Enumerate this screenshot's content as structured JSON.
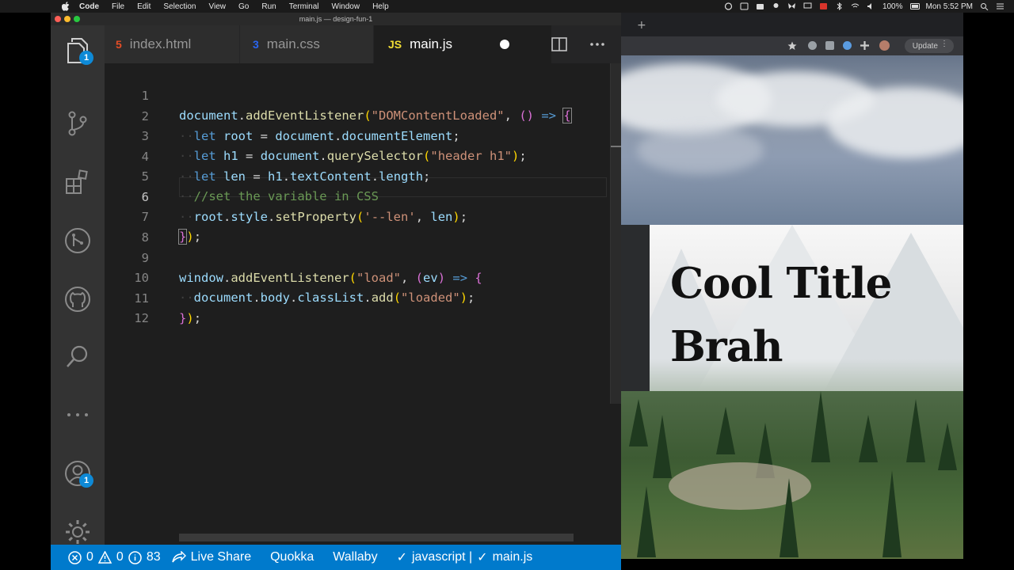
{
  "menubar": {
    "app_name": "Code",
    "items": [
      "File",
      "Edit",
      "Selection",
      "View",
      "Go",
      "Run",
      "Terminal",
      "Window",
      "Help"
    ],
    "battery": "100%",
    "clock": "Mon 5:52 PM"
  },
  "window": {
    "title": "main.js — design-fun-1"
  },
  "activity_bar": {
    "explorer_badge": "1",
    "accounts_badge": "1",
    "icons": [
      "files-icon",
      "source-control-icon",
      "extensions-icon",
      "git-graph-icon",
      "github-icon",
      "search-icon",
      "more-icon",
      "accounts-icon",
      "gear-icon"
    ]
  },
  "tabs": [
    {
      "label": "index.html",
      "icon": "html5-icon",
      "color": "#e44d26",
      "glyph": "5"
    },
    {
      "label": "main.css",
      "icon": "css3-icon",
      "color": "#2965f1",
      "glyph": "3"
    },
    {
      "label": "main.js",
      "icon": "js-icon",
      "color": "#f1dd35",
      "glyph": "JS",
      "active": true,
      "modified": true
    }
  ],
  "editor": {
    "current_line": 6,
    "lines": [
      {
        "n": "1"
      },
      {
        "n": "2"
      },
      {
        "n": "3"
      },
      {
        "n": "4"
      },
      {
        "n": "5"
      },
      {
        "n": "6"
      },
      {
        "n": "7"
      },
      {
        "n": "8"
      },
      {
        "n": "9"
      },
      {
        "n": "10"
      },
      {
        "n": "11"
      },
      {
        "n": "12"
      }
    ]
  },
  "statusbar": {
    "errors": "0",
    "warnings": "0",
    "info": "83",
    "live_share": "Live Share",
    "quokka": "Quokka",
    "wallaby": "Wallaby",
    "language": "javascript | ",
    "file": "main.js"
  },
  "browser": {
    "update_label": "Update",
    "hero_title": "Cool Title Brah"
  },
  "colors": {
    "accent": "#007acc",
    "activity_bar": "#333333",
    "editor_bg": "#1e1e1e"
  }
}
